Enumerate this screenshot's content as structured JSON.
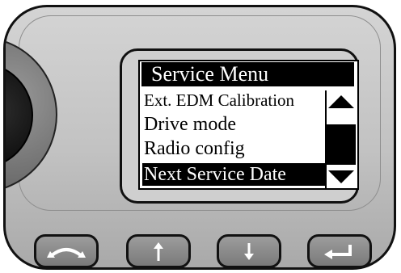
{
  "screen": {
    "title": "Service Menu",
    "items": [
      {
        "label": "Ext. EDM Calibration",
        "selected": false
      },
      {
        "label": "Drive mode",
        "selected": false
      },
      {
        "label": "Radio config",
        "selected": false
      },
      {
        "label": "Next Service Date",
        "selected": true
      }
    ]
  },
  "scrollbar": {
    "up_icon": "triangle-up-icon",
    "down_icon": "triangle-down-icon"
  },
  "keys": [
    {
      "name": "back-button",
      "icon": "curved-arrow-icon"
    },
    {
      "name": "up-button",
      "icon": "arrow-up-icon"
    },
    {
      "name": "down-button",
      "icon": "arrow-down-icon"
    },
    {
      "name": "enter-button",
      "icon": "enter-return-icon"
    }
  ],
  "colors": {
    "screen_bg": "#ffffff",
    "highlight": "#000000",
    "device_body": "#c4c4c4"
  }
}
